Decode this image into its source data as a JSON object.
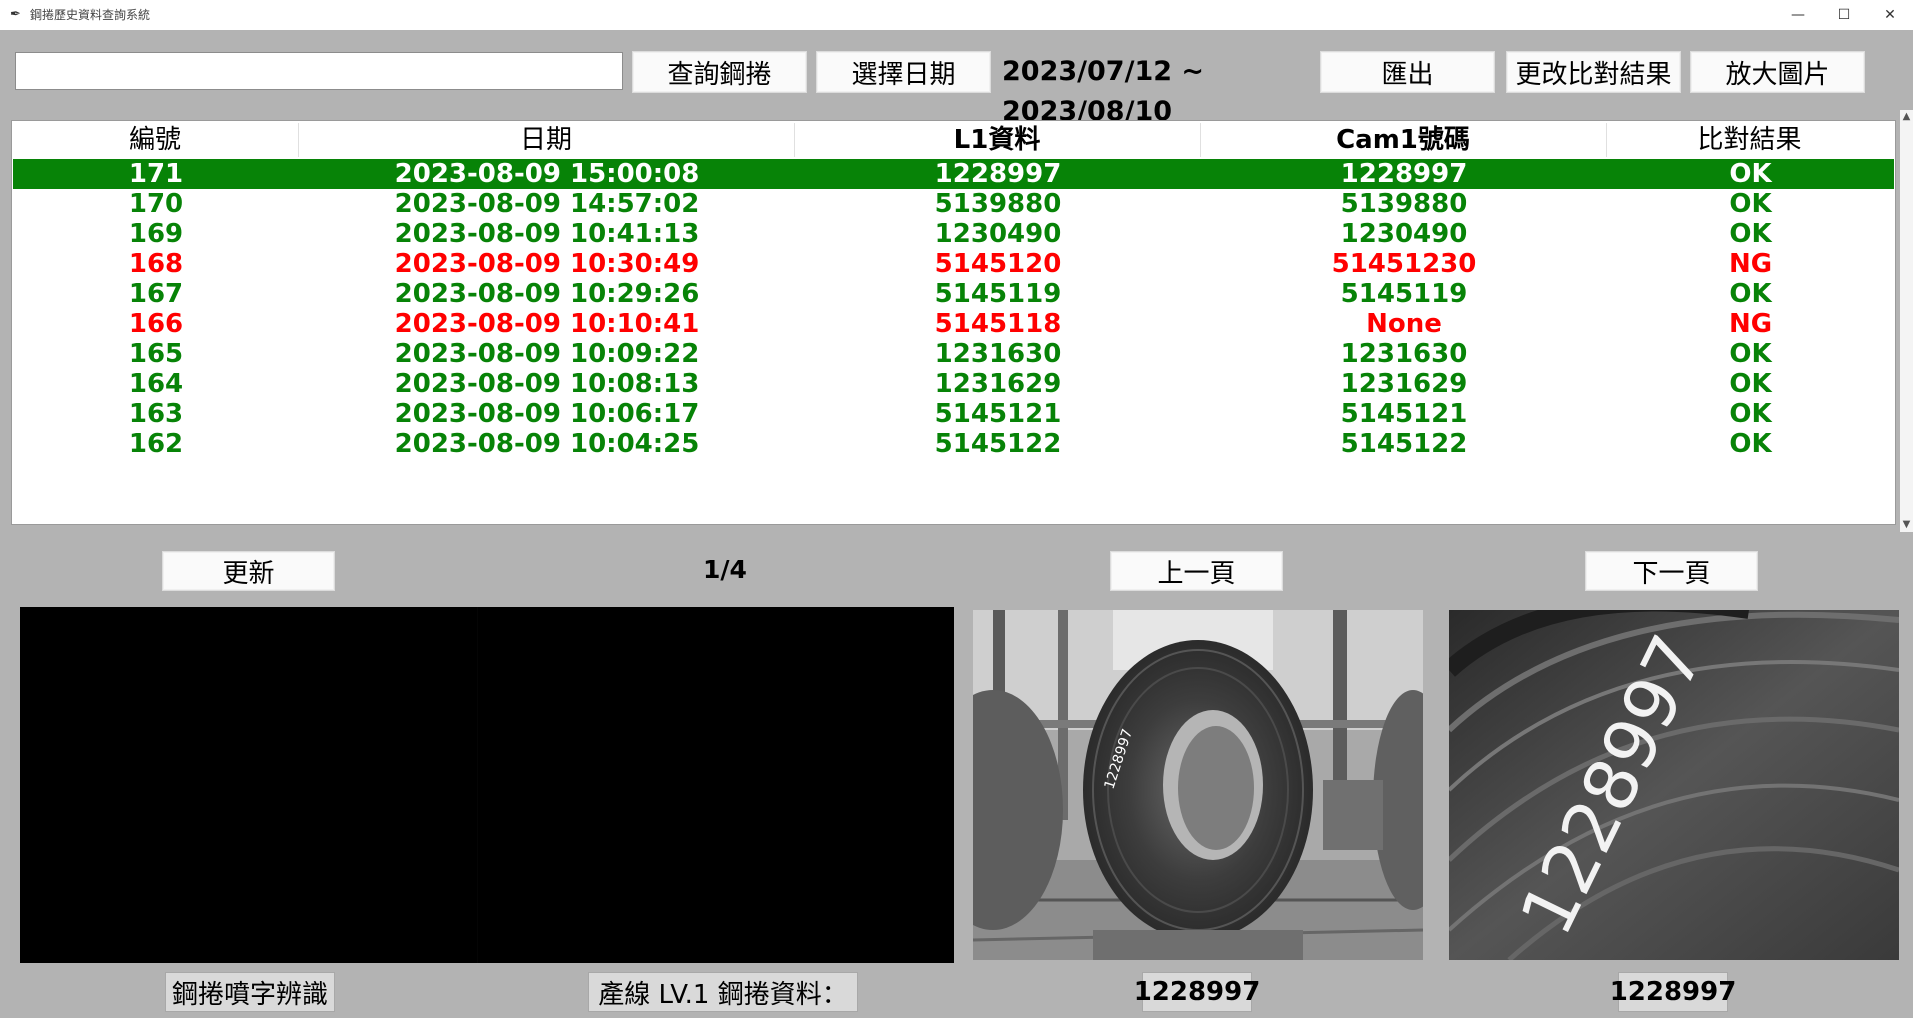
{
  "window": {
    "title": "鋼捲歷史資料查詢系統",
    "minimize": "—",
    "maximize": "☐",
    "close": "✕"
  },
  "toolbar": {
    "search_value": "",
    "query_label": "查詢鋼捲",
    "select_date_label": "選擇日期",
    "date_range": "2023/07/12 ~ 2023/08/10",
    "export_label": "匯出",
    "change_result_label": "更改比對結果",
    "enlarge_label": "放大圖片"
  },
  "table": {
    "headers": [
      "編號",
      "日期",
      "L1資料",
      "Cam1號碼",
      "比對結果"
    ],
    "rows": [
      {
        "id": "171",
        "date": "2023-08-09 15:00:08",
        "l1": "1228997",
        "cam1": "1228997",
        "result": "OK",
        "selected": true
      },
      {
        "id": "170",
        "date": "2023-08-09 14:57:02",
        "l1": "5139880",
        "cam1": "5139880",
        "result": "OK"
      },
      {
        "id": "169",
        "date": "2023-08-09 10:41:13",
        "l1": "1230490",
        "cam1": "1230490",
        "result": "OK"
      },
      {
        "id": "168",
        "date": "2023-08-09 10:30:49",
        "l1": "5145120",
        "cam1": "51451230",
        "result": "NG"
      },
      {
        "id": "167",
        "date": "2023-08-09 10:29:26",
        "l1": "5145119",
        "cam1": "5145119",
        "result": "OK"
      },
      {
        "id": "166",
        "date": "2023-08-09 10:10:41",
        "l1": "5145118",
        "cam1": "None",
        "result": "NG"
      },
      {
        "id": "165",
        "date": "2023-08-09 10:09:22",
        "l1": "1231630",
        "cam1": "1231630",
        "result": "OK"
      },
      {
        "id": "164",
        "date": "2023-08-09 10:08:13",
        "l1": "1231629",
        "cam1": "1231629",
        "result": "OK"
      },
      {
        "id": "163",
        "date": "2023-08-09 10:06:17",
        "l1": "5145121",
        "cam1": "5145121",
        "result": "OK"
      },
      {
        "id": "162",
        "date": "2023-08-09 10:04:25",
        "l1": "5145122",
        "cam1": "5145122",
        "result": "OK"
      }
    ]
  },
  "pagination": {
    "refresh_label": "更新",
    "page": "1/4",
    "prev_label": "上一頁",
    "next_label": "下一頁"
  },
  "images": {
    "coil_number_text": "1228997"
  },
  "bottom": {
    "ocr_label": "鋼捲噴字辨識",
    "l1_label": "產線 LV.1 鋼捲資料：",
    "cam_photo_value": "1228997",
    "crop_photo_value": "1228997"
  },
  "colors": {
    "ok": "#078307",
    "ng": "#ff0000",
    "selected_row": "#078307",
    "background": "#b3b3b3"
  }
}
